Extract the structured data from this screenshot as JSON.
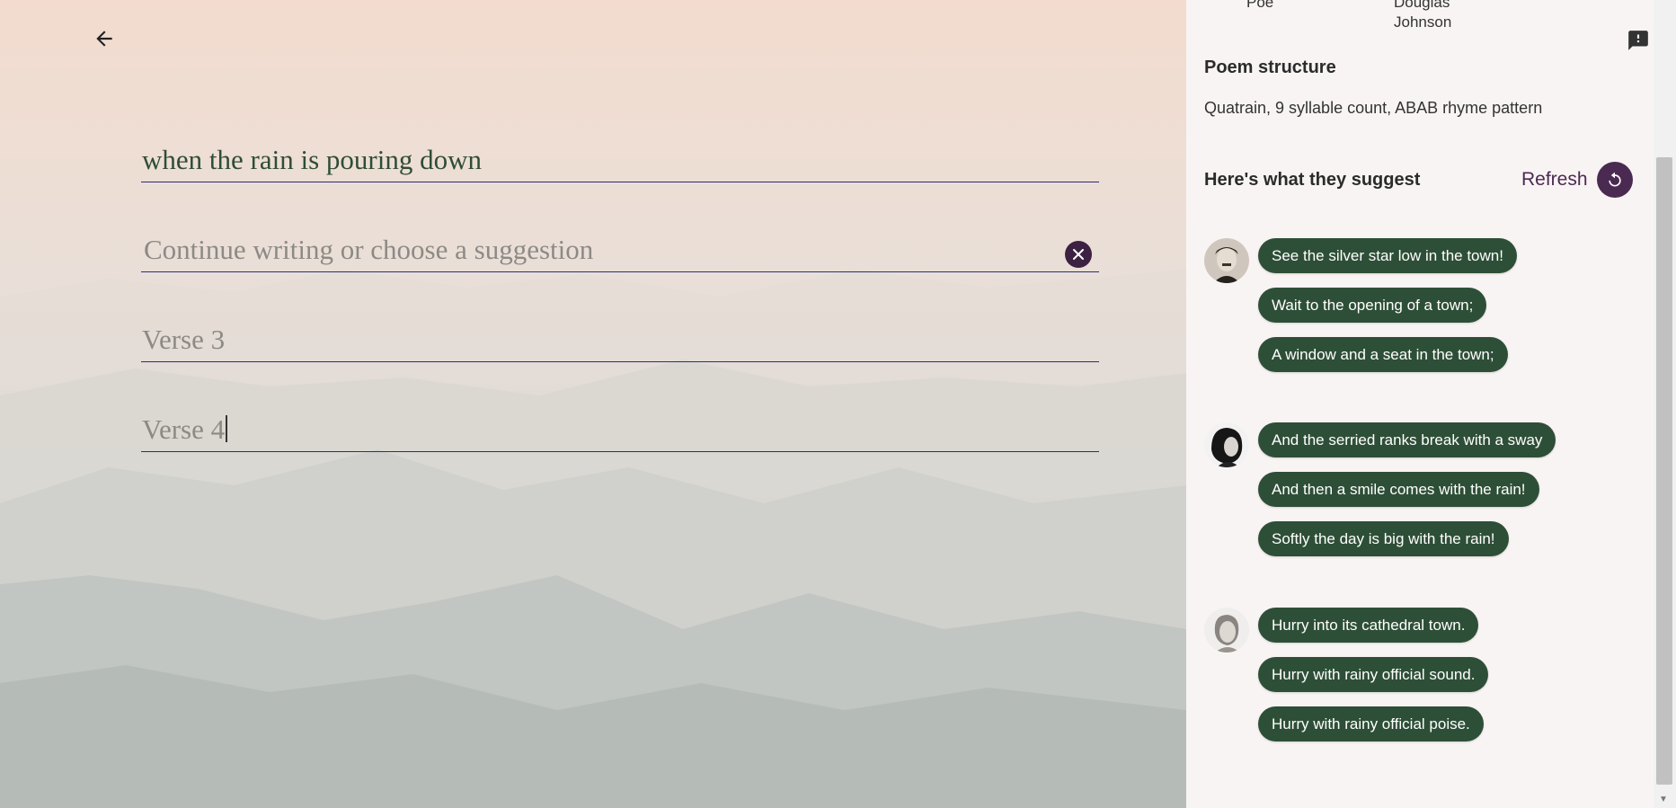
{
  "editor": {
    "verses": [
      {
        "value": "when the rain is pouring down",
        "placeholder": ""
      },
      {
        "value": "",
        "placeholder": "Continue writing or choose a suggestion"
      },
      {
        "value": "",
        "placeholder": "Verse 3"
      },
      {
        "value": "",
        "placeholder": "Verse 4"
      }
    ]
  },
  "panel": {
    "authors": [
      "Poe",
      "Douglas Johnson"
    ],
    "structure_title": "Poem structure",
    "structure_text": "Quatrain, 9 syllable count, ABAB rhyme pattern",
    "suggest_title": "Here's what they suggest",
    "refresh_label": "Refresh",
    "groups": [
      {
        "suggestions": [
          "See the silver star low in the town!",
          "Wait to the opening of a town;",
          "A window and a seat in the town;"
        ]
      },
      {
        "suggestions": [
          "And the serried ranks break with a sway",
          "And then a smile comes with the rain!",
          "Softly the day is big with the rain!"
        ]
      },
      {
        "suggestions": [
          "Hurry into its cathedral town.",
          "Hurry with rainy official sound.",
          "Hurry with rainy official poise."
        ]
      }
    ]
  },
  "colors": {
    "accent": "#4b2a52",
    "chip": "#2e4f37",
    "line": "#2a2f7a"
  },
  "icons": [
    "back-arrow-icon",
    "close-icon",
    "refresh-icon",
    "feedback-icon"
  ]
}
